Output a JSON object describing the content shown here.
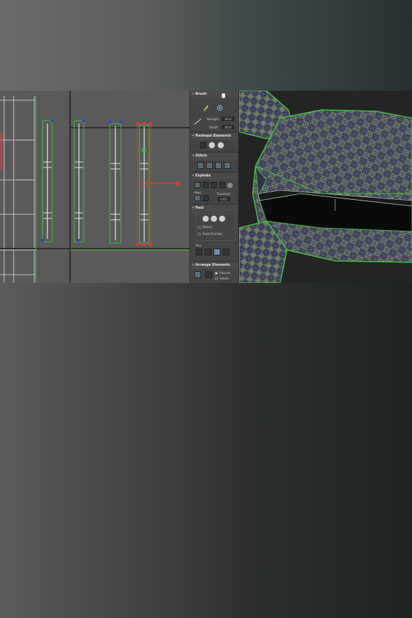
{
  "panel": {
    "brush": {
      "title": "Brush",
      "strength_label": "Strength:",
      "strength_value": "20.0",
      "falloff_label": "Falloff:",
      "falloff_value": "20.0"
    },
    "reshape": {
      "title": "Reshape Elements"
    },
    "stitch": {
      "title": "Stitch"
    },
    "explode": {
      "title": "Explode",
      "weld_label": "Weld",
      "threshold_label": "Threshold:",
      "threshold_value": "0.01"
    },
    "peel": {
      "title": "Peel",
      "detach_label": "Detach",
      "avoid_overlap_label": "Avoid Overlap",
      "pins_label": "Pins"
    },
    "arrange": {
      "title": "Arrange Elements",
      "rescale_label": "Rescale",
      "rotate_label": "Rotate"
    }
  },
  "icons": {
    "cursor": "mouse-cursor-icon",
    "relax": "brush-relax-icon",
    "arrow": "selection-arrow-red-icon"
  },
  "colors": {
    "uv_green": "#3fc63a",
    "uv_blue": "#2e3fd8",
    "uv_red": "#e03a2a",
    "panel_bg": "#444444",
    "checker_dark": "#3a3d5a",
    "checker_light": "#6b7a62"
  }
}
